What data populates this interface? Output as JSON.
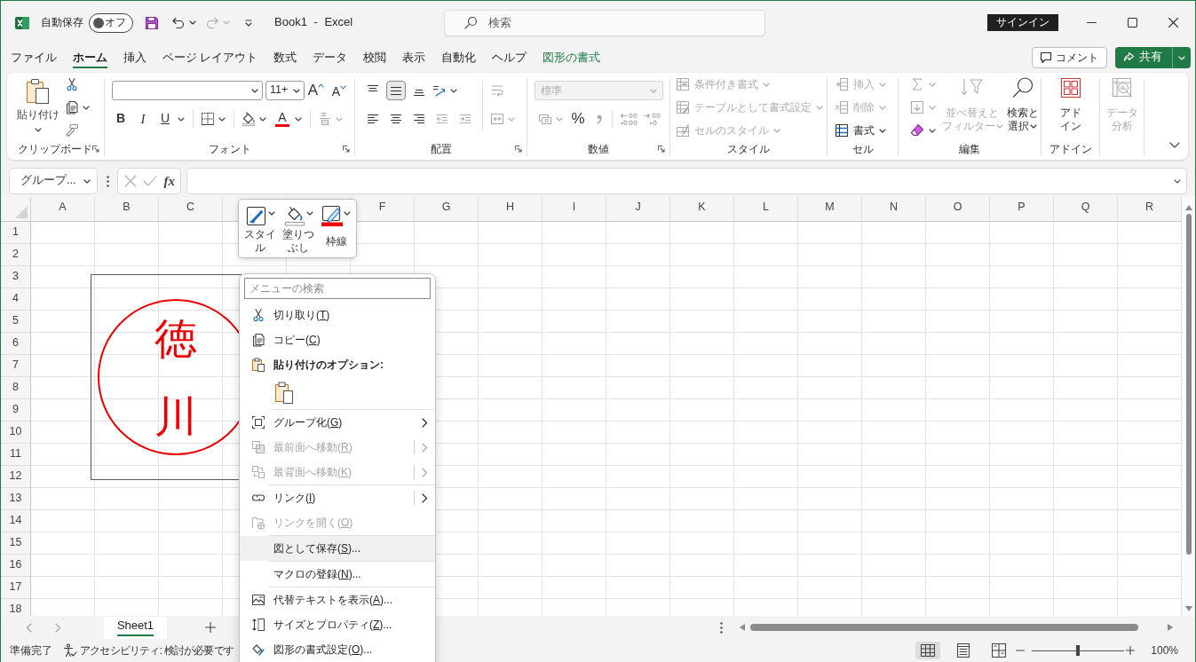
{
  "title_bar": {
    "autosave_label": "自動保存",
    "autosave_toggle": {
      "label": "オフ",
      "on": false
    },
    "undo": {
      "disabled": false
    },
    "redo": {
      "disabled": true
    },
    "title": "Book1 - Excel",
    "search": {
      "placeholder": "検索"
    },
    "sign_in": "サインイン"
  },
  "ribbon_tabs": [
    {
      "label": "ファイル",
      "selected": false,
      "kind": "standard"
    },
    {
      "label": "ホーム",
      "selected": true,
      "kind": "standard"
    },
    {
      "label": "挿入",
      "selected": false,
      "kind": "standard"
    },
    {
      "label": "ページ レイアウト",
      "selected": false,
      "kind": "standard"
    },
    {
      "label": "数式",
      "selected": false,
      "kind": "standard"
    },
    {
      "label": "データ",
      "selected": false,
      "kind": "standard"
    },
    {
      "label": "校閲",
      "selected": false,
      "kind": "standard"
    },
    {
      "label": "表示",
      "selected": false,
      "kind": "standard"
    },
    {
      "label": "自動化",
      "selected": false,
      "kind": "standard"
    },
    {
      "label": "ヘルプ",
      "selected": false,
      "kind": "standard"
    },
    {
      "label": "図形の書式",
      "selected": false,
      "kind": "contextual"
    }
  ],
  "tab_actions": {
    "comment": "コメント",
    "share": "共有"
  },
  "ribbon_groups": [
    {
      "kind": "clipboard",
      "label": "クリップボード",
      "launcher": true,
      "paste_label": "貼り付け"
    },
    {
      "kind": "font",
      "label": "フォント",
      "launcher": true,
      "font_size": "11+",
      "grow_label": "A",
      "shrink_label": "A",
      "bold_label": "B",
      "italic_label": "I",
      "underline_label": "U",
      "font_color_label": "A",
      "phonetic": {
        "disabled": true
      }
    },
    {
      "kind": "alignment",
      "label": "配置",
      "launcher": true,
      "vertical": [
        {
          "selected": false
        },
        {
          "selected": true
        },
        {
          "selected": false
        }
      ],
      "horizontal": [
        {
          "selected": false
        },
        {
          "selected": false
        },
        {
          "selected": false
        }
      ],
      "indent": [
        {
          "disabled": true
        },
        {
          "disabled": true
        }
      ],
      "wrap": {
        "disabled": true
      },
      "merge": {
        "disabled": true
      }
    },
    {
      "kind": "number",
      "label": "数値",
      "launcher": true,
      "format": "標準",
      "percent_label": "%",
      "disabled": true
    },
    {
      "kind": "styles",
      "label": "スタイル",
      "items": [
        {
          "label": "条件付き書式",
          "disabled": true
        },
        {
          "label": "テーブルとして書式設定",
          "disabled": true
        },
        {
          "label": "セルのスタイル",
          "disabled": true
        }
      ]
    },
    {
      "kind": "cells",
      "label": "セル",
      "items": [
        {
          "label": "挿入",
          "disabled": true
        },
        {
          "label": "削除",
          "disabled": true
        },
        {
          "label": "書式",
          "disabled": false
        }
      ]
    },
    {
      "kind": "editing",
      "label": "編集",
      "tools": [
        {
          "disabled": true
        },
        {
          "disabled": true
        },
        {
          "disabled": false
        }
      ],
      "buttons": [
        {
          "lines": [
            "並べ替えと",
            "フィルター"
          ],
          "disabled": true,
          "dropdown": true
        },
        {
          "lines": [
            "検索と",
            "選択"
          ],
          "disabled": false,
          "dropdown": true
        }
      ]
    },
    {
      "kind": "addins",
      "label": "アドイン",
      "buttons": [
        {
          "lines": [
            "アド",
            "イン"
          ],
          "disabled": false
        }
      ]
    },
    {
      "kind": "analysis",
      "buttons": [
        {
          "lines": [
            "データ",
            "分析"
          ],
          "disabled": true
        }
      ]
    }
  ],
  "formula_bar": {
    "name_box": "グループ...",
    "cancel": {
      "disabled": true
    },
    "enter": {
      "disabled": true
    },
    "function_label": "fx"
  },
  "sheet": {
    "columns_left": [
      "A",
      "B",
      "C"
    ],
    "columns_right": [
      "F",
      "G",
      "H",
      "I",
      "J",
      "K",
      "L",
      "M",
      "N",
      "O",
      "P",
      "Q",
      "R"
    ],
    "rows": [
      "1",
      "2",
      "3",
      "4",
      "5",
      "6",
      "7",
      "8",
      "9",
      "10",
      "11",
      "12",
      "13",
      "14",
      "15",
      "16",
      "17",
      "18"
    ],
    "shape": {
      "characters": [
        "徳",
        "川"
      ]
    }
  },
  "mini_toolbar": {
    "buttons": [
      {
        "label": "スタイル"
      },
      {
        "label": "塗りつぶし"
      },
      {
        "label": "枠線"
      }
    ]
  },
  "context_menu": {
    "search": {
      "placeholder": "メニューの検索"
    },
    "items": [
      {
        "kind": "command",
        "label": "切り取り(T)",
        "disabled": false,
        "highlighted": false
      },
      {
        "kind": "command",
        "label": "コピー(C)",
        "disabled": false,
        "highlighted": false
      },
      {
        "kind": "header",
        "label": "貼り付けのオプション:"
      },
      {
        "kind": "paste_options"
      },
      {
        "kind": "separator"
      },
      {
        "kind": "command",
        "label": "グループ化(G)",
        "disabled": false,
        "highlighted": false,
        "submenu": true,
        "split": false
      },
      {
        "kind": "command",
        "label": "最前面へ移動(R)",
        "disabled": true,
        "highlighted": false,
        "submenu": true,
        "split": true
      },
      {
        "kind": "command",
        "label": "最背面へ移動(K)",
        "disabled": true,
        "highlighted": false,
        "submenu": true,
        "split": true
      },
      {
        "kind": "separator"
      },
      {
        "kind": "command",
        "label": "リンク(I)",
        "disabled": false,
        "highlighted": false,
        "submenu": true,
        "split": true
      },
      {
        "kind": "command",
        "label": "リンクを開く(O)",
        "disabled": true,
        "highlighted": false
      },
      {
        "kind": "separator"
      },
      {
        "kind": "command",
        "label": "図として保存(S)...",
        "disabled": false,
        "highlighted": true
      },
      {
        "kind": "separator"
      },
      {
        "kind": "command",
        "label": "マクロの登録(N)...",
        "disabled": false,
        "highlighted": false
      },
      {
        "kind": "separator"
      },
      {
        "kind": "command",
        "label": "代替テキストを表示(A)...",
        "disabled": false,
        "highlighted": false
      },
      {
        "kind": "command",
        "label": "サイズとプロパティ(Z)...",
        "disabled": false,
        "highlighted": false
      },
      {
        "kind": "command",
        "label": "図形の書式設定(O)...",
        "disabled": false,
        "highlighted": false
      }
    ]
  },
  "sheet_tabs": {
    "sheets": [
      {
        "label": "Sheet1",
        "selected": true
      }
    ]
  },
  "status_bar": {
    "ready": "準備完了",
    "accessibility": "アクセシビリティ: 検討が必要です",
    "views": [
      {
        "selected": true
      },
      {
        "selected": false
      },
      {
        "selected": false
      }
    ],
    "zoom": {
      "level": 0.5,
      "reading": "100%"
    }
  }
}
